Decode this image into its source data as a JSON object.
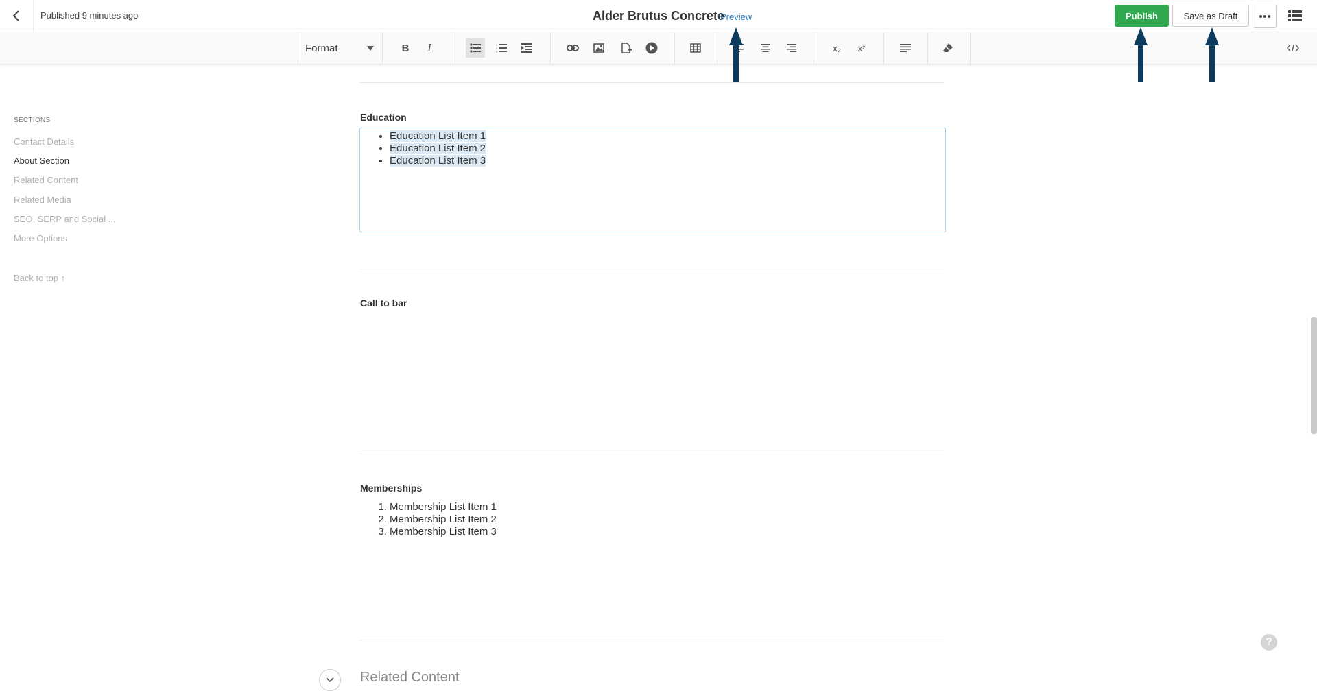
{
  "header": {
    "status": "Published 9 minutes ago",
    "title": "Alder Brutus Concrete",
    "preview_label": "Preview",
    "publish_label": "Publish",
    "draft_label": "Save as Draft"
  },
  "toolbar": {
    "format_label": "Format",
    "bold": "B",
    "italic": "I",
    "subscript": "x₂",
    "superscript": "x²"
  },
  "sidebar": {
    "heading": "SECTIONS",
    "items": [
      {
        "label": "Contact Details"
      },
      {
        "label": "About Section"
      },
      {
        "label": "Related Content"
      },
      {
        "label": "Related Media"
      },
      {
        "label": "SEO, SERP and Social ..."
      },
      {
        "label": "More Options"
      }
    ],
    "back_to_top": "Back to top ↑"
  },
  "main": {
    "education": {
      "label": "Education",
      "items": [
        "Education List Item 1",
        "Education List Item 2",
        "Education List Item 3"
      ]
    },
    "call_to_bar": {
      "label": "Call to bar"
    },
    "memberships": {
      "label": "Memberships",
      "items": [
        "Membership List Item 1",
        "Membership List Item 2",
        "Membership List Item 3"
      ]
    },
    "related_content_title": "Related Content"
  },
  "colors": {
    "publish_green": "#2fa84f",
    "link_blue": "#2a7ab8",
    "arrow_navy": "#0d3b5e"
  }
}
